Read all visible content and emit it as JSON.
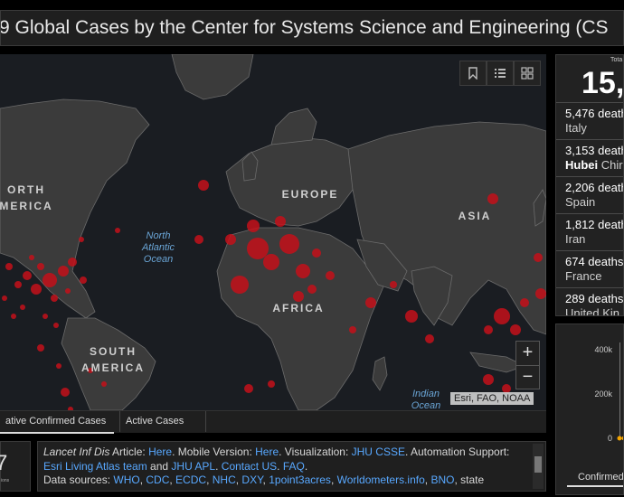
{
  "header": {
    "title": "9 Global Cases by the Center for Systems Science and Engineering (CS"
  },
  "map": {
    "labels": {
      "north_america": "ORTH\nMERICA",
      "europe": "EUROPE",
      "asia": "ASIA",
      "africa": "AFRICA",
      "south_america": "SOUTH\nAMERICA"
    },
    "oceans": {
      "north_atlantic": "North\nAtlantic\nOcean",
      "indian": "Indian\nOcean"
    },
    "tool_icons": [
      "bookmark-icon",
      "legend-list-icon",
      "basemap-grid-icon"
    ],
    "zoom_in": "+",
    "zoom_out": "−",
    "attribution": "Esri, FAO, NOAA",
    "colors": {
      "background": "#1a1d22",
      "land": "#3b3b3b",
      "border": "#6b6b6b",
      "bubble": "#c4101a"
    }
  },
  "tabs": [
    {
      "label": "ative Confirmed Cases",
      "active": true
    },
    {
      "label": "Active Cases",
      "active": false
    }
  ],
  "last_updated": {
    "number": "7",
    "caption": "ions"
  },
  "info": {
    "journal": "Lancet Inf Dis",
    "article_label": " Article: ",
    "here1": "Here",
    "mobile_label": ". Mobile Version: ",
    "here2": "Here",
    "viz_label": ". Visualization: ",
    "jhu_csse": "JHU CSSE",
    "automation_label": ". Automation Support: ",
    "esri": "Esri Living Atlas team",
    "and_label": " and ",
    "jhu_apl": "JHU APL",
    "sep1": ". ",
    "contact": "Contact US",
    "sep2": ". ",
    "faq": "FAQ",
    "sep3": ".",
    "sources_label": "Data sources: ",
    "sources": [
      "WHO",
      "CDC",
      "ECDC",
      "NHC",
      "DXY",
      "1point3acres",
      "Worldometers.info",
      "BNO"
    ],
    "sources_tail": ", state"
  },
  "total_panel": {
    "label": "Tota",
    "number": "15,",
    "entries": [
      {
        "deaths": "5,476 death",
        "place": "Italy",
        "bold": ""
      },
      {
        "deaths": "3,153 death",
        "place": " Chir",
        "bold": "Hubei"
      },
      {
        "deaths": "2,206 death",
        "place": "Spain",
        "bold": ""
      },
      {
        "deaths": "1,812 death",
        "place": "Iran",
        "bold": ""
      },
      {
        "deaths": "674 deaths",
        "place": "France",
        "bold": ""
      },
      {
        "deaths": "289 deaths",
        "place": "United Kin",
        "bold": ""
      }
    ]
  },
  "chart_panel": {
    "y_ticks": [
      "400k",
      "200k",
      "0"
    ],
    "tab_label": "Confirmed"
  }
}
